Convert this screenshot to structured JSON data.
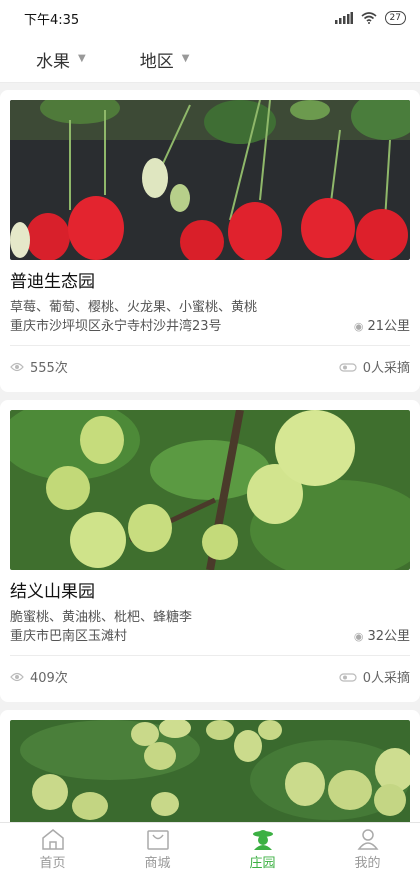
{
  "status_bar": {
    "time": "下午4:35",
    "battery": "27"
  },
  "filters": {
    "fruit_label": "水果",
    "region_label": "地区"
  },
  "farms": [
    {
      "name": "普迪生态园",
      "fruits": "草莓、葡萄、樱桃、火龙果、小蜜桃、黄桃",
      "address": "重庆市沙坪坝区永宁寺村沙井湾23号",
      "distance": "21公里",
      "views": "555次",
      "pickers": "0人采摘"
    },
    {
      "name": "结义山果园",
      "fruits": "脆蜜桃、黄油桃、枇杷、蜂糖李",
      "address": "重庆市巴南区玉滩村",
      "distance": "32公里",
      "views": "409次",
      "pickers": "0人采摘"
    }
  ],
  "tabs": [
    {
      "label": "首页",
      "icon": "home-icon"
    },
    {
      "label": "商城",
      "icon": "shop-bag-icon"
    },
    {
      "label": "庄园",
      "icon": "farmer-icon",
      "active": true
    },
    {
      "label": "我的",
      "icon": "person-icon"
    }
  ],
  "colors": {
    "accent": "#3cb043",
    "background": "#f2f2f2"
  }
}
